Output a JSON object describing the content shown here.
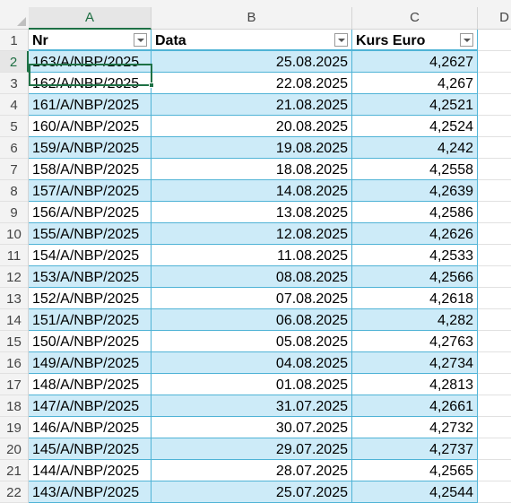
{
  "columns": [
    {
      "letter": "A",
      "selected": true
    },
    {
      "letter": "B",
      "selected": false
    },
    {
      "letter": "C",
      "selected": false
    },
    {
      "letter": "D",
      "selected": false
    }
  ],
  "header_row": {
    "row_number": "1",
    "nr": "Nr",
    "data": "Data",
    "kurs": "Kurs Euro"
  },
  "rows": [
    {
      "row_number": "2",
      "nr": "163/A/NBP/2025",
      "data": "25.08.2025",
      "kurs": "4,2627",
      "selected": true
    },
    {
      "row_number": "3",
      "nr": "162/A/NBP/2025",
      "data": "22.08.2025",
      "kurs": "4,267"
    },
    {
      "row_number": "4",
      "nr": "161/A/NBP/2025",
      "data": "21.08.2025",
      "kurs": "4,2521"
    },
    {
      "row_number": "5",
      "nr": "160/A/NBP/2025",
      "data": "20.08.2025",
      "kurs": "4,2524"
    },
    {
      "row_number": "6",
      "nr": "159/A/NBP/2025",
      "data": "19.08.2025",
      "kurs": "4,242"
    },
    {
      "row_number": "7",
      "nr": "158/A/NBP/2025",
      "data": "18.08.2025",
      "kurs": "4,2558"
    },
    {
      "row_number": "8",
      "nr": "157/A/NBP/2025",
      "data": "14.08.2025",
      "kurs": "4,2639"
    },
    {
      "row_number": "9",
      "nr": "156/A/NBP/2025",
      "data": "13.08.2025",
      "kurs": "4,2586"
    },
    {
      "row_number": "10",
      "nr": "155/A/NBP/2025",
      "data": "12.08.2025",
      "kurs": "4,2626"
    },
    {
      "row_number": "11",
      "nr": "154/A/NBP/2025",
      "data": "11.08.2025",
      "kurs": "4,2533"
    },
    {
      "row_number": "12",
      "nr": "153/A/NBP/2025",
      "data": "08.08.2025",
      "kurs": "4,2566"
    },
    {
      "row_number": "13",
      "nr": "152/A/NBP/2025",
      "data": "07.08.2025",
      "kurs": "4,2618"
    },
    {
      "row_number": "14",
      "nr": "151/A/NBP/2025",
      "data": "06.08.2025",
      "kurs": "4,282"
    },
    {
      "row_number": "15",
      "nr": "150/A/NBP/2025",
      "data": "05.08.2025",
      "kurs": "4,2763"
    },
    {
      "row_number": "16",
      "nr": "149/A/NBP/2025",
      "data": "04.08.2025",
      "kurs": "4,2734"
    },
    {
      "row_number": "17",
      "nr": "148/A/NBP/2025",
      "data": "01.08.2025",
      "kurs": "4,2813"
    },
    {
      "row_number": "18",
      "nr": "147/A/NBP/2025",
      "data": "31.07.2025",
      "kurs": "4,2661"
    },
    {
      "row_number": "19",
      "nr": "146/A/NBP/2025",
      "data": "30.07.2025",
      "kurs": "4,2732"
    },
    {
      "row_number": "20",
      "nr": "145/A/NBP/2025",
      "data": "29.07.2025",
      "kurs": "4,2737"
    },
    {
      "row_number": "21",
      "nr": "144/A/NBP/2025",
      "data": "28.07.2025",
      "kurs": "4,2565"
    },
    {
      "row_number": "22",
      "nr": "143/A/NBP/2025",
      "data": "25.07.2025",
      "kurs": "4,2544"
    }
  ],
  "colors": {
    "band": "#cdebf8",
    "table_border": "#4fb3d6",
    "selection": "#1e7145"
  },
  "icons": {
    "filter": "filter-dropdown-icon",
    "select_all": "select-all-triangle-icon"
  }
}
